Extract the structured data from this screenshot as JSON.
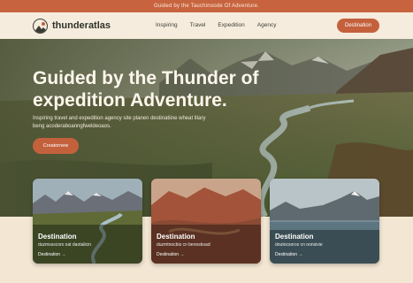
{
  "announcement": "Guided by the Tauchinoode Of Adventure.",
  "brand": {
    "name": "thunderatlas",
    "logo_icon": "mountain-logo-icon"
  },
  "nav": {
    "links": [
      "Inspiring",
      "Travel",
      "Expedition",
      "Agency"
    ],
    "cta": "Destination"
  },
  "hero": {
    "title_line1": "Guided by the Thunder of",
    "title_line2": "expedition Adventure.",
    "subtitle": "Inspiring travel and expedition agency site planen destinatiine wheat litary beng acoderaboanngfweldeoaos.",
    "button": "Creatornew"
  },
  "cards": [
    {
      "title": "Destination",
      "desc": "duzmssscors oat daotalicin",
      "link": "Destination →"
    },
    {
      "title": "Destination",
      "desc": "duzmtnocbis cn benoskoad",
      "link": "Destination →"
    },
    {
      "title": "Destination",
      "desc": "doutocsorce cn oonsivie",
      "link": "Destination →"
    }
  ],
  "colors": {
    "accent": "#c4613d",
    "announcement_bg": "#c7643f",
    "nav_bg": "#f6ecdd",
    "page_bg": "#f3e7d3"
  }
}
